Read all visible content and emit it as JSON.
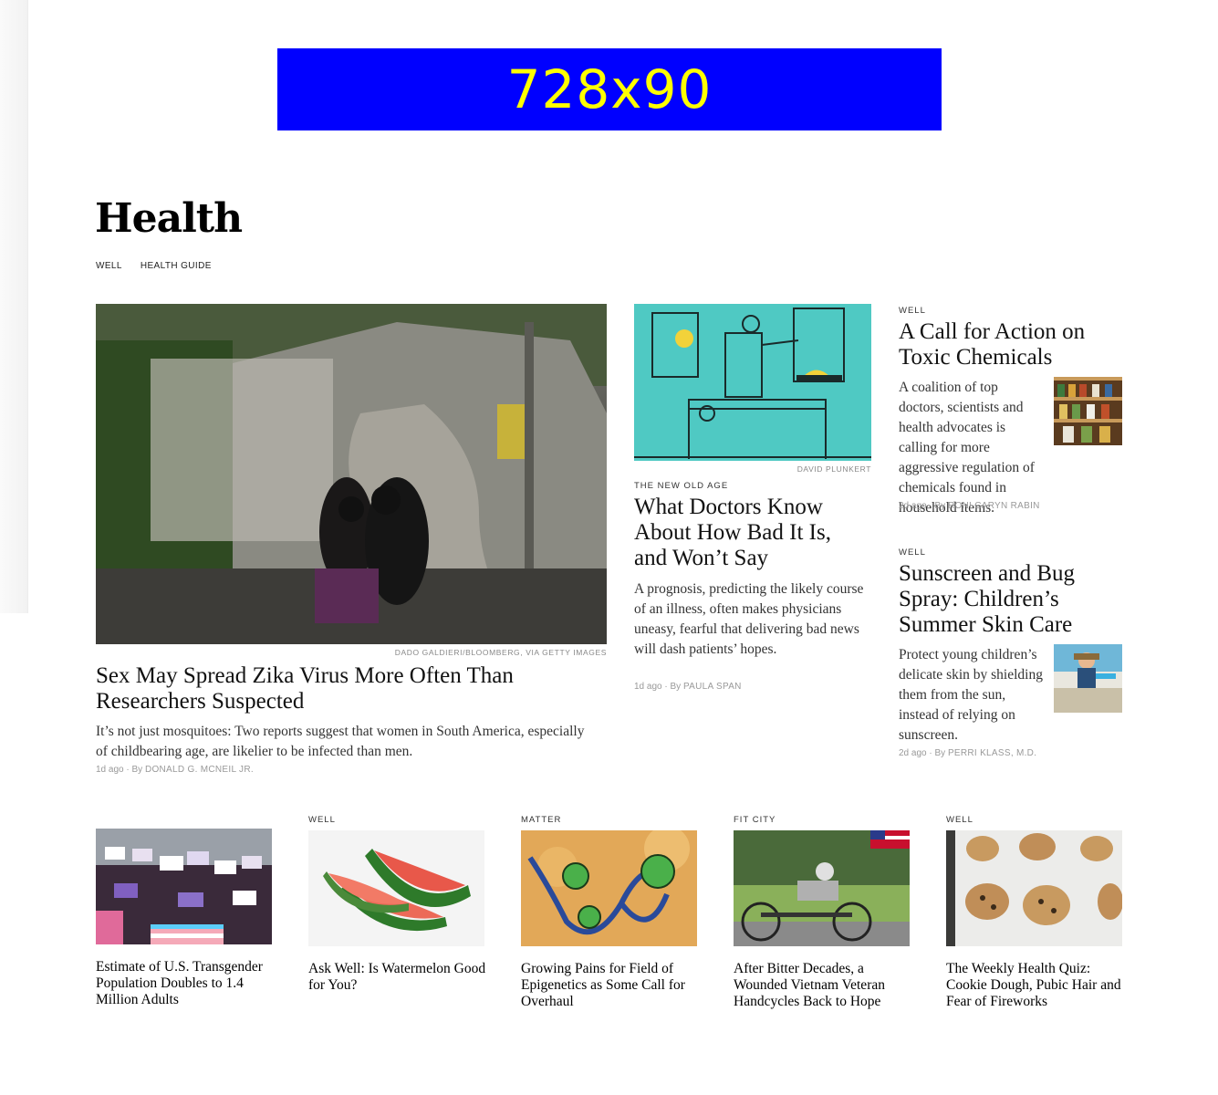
{
  "ad": {
    "label": "728x90"
  },
  "section": {
    "title": "Health",
    "subnav": [
      "WELL",
      "HEALTH GUIDE"
    ]
  },
  "lead": {
    "credit": "DADO GALDIERI/BLOOMBERG, VIA GETTY IMAGES",
    "headline": "Sex May Spread Zika Virus More Often Than Researchers Suspected",
    "summary": "It’s not just mosquitoes: Two reports suggest that women in South America, especially of childbearing age, are likelier to be infected than men.",
    "time": "1d ago",
    "by": "By",
    "author": "DONALD G. McNEIL Jr."
  },
  "middle": {
    "credit": "DAVID PLUNKERT",
    "kicker": "THE NEW OLD AGE",
    "headline": "What Doctors Know About How Bad It Is, and Won’t Say",
    "summary": "A prognosis, predicting the likely course of an illness, often makes physicians uneasy, fearful that delivering bad news will dash patients’ hopes.",
    "time": "1d ago",
    "by": "By",
    "author": "PAULA SPAN"
  },
  "right": [
    {
      "kicker": "WELL",
      "headline": "A Call for Action on Toxic Chemicals",
      "summary": "A coalition of top doctors, scientists and health advocates is calling for more aggressive regulation of chemicals found in household items.",
      "time": "2d ago",
      "by": "By",
      "author": "RONI CARYN RABIN"
    },
    {
      "kicker": "WELL",
      "headline": "Sunscreen and Bug Spray: Children’s Summer Skin Care",
      "summary": "Protect young children’s delicate skin by shielding them from the sun, instead of relying on sunscreen.",
      "time": "2d ago",
      "by": "By",
      "author": "PERRI KLASS, M.D."
    }
  ],
  "bottom": [
    {
      "kicker": "",
      "headline": "Estimate of U.S. Transgender Population Doubles to 1.4 Million Adults"
    },
    {
      "kicker": "WELL",
      "headline": "Ask Well: Is Watermelon Good for You?"
    },
    {
      "kicker": "MATTER",
      "headline": "Growing Pains for Field of Epigenetics as Some Call for Overhaul"
    },
    {
      "kicker": "FIT CITY",
      "headline": "After Bitter Decades, a Wounded Vietnam Veteran Handcycles Back to Hope"
    },
    {
      "kicker": "WELL",
      "headline": "The Weekly Health Quiz: Cookie Dough, Pubic Hair and Fear of Fireworks"
    }
  ]
}
